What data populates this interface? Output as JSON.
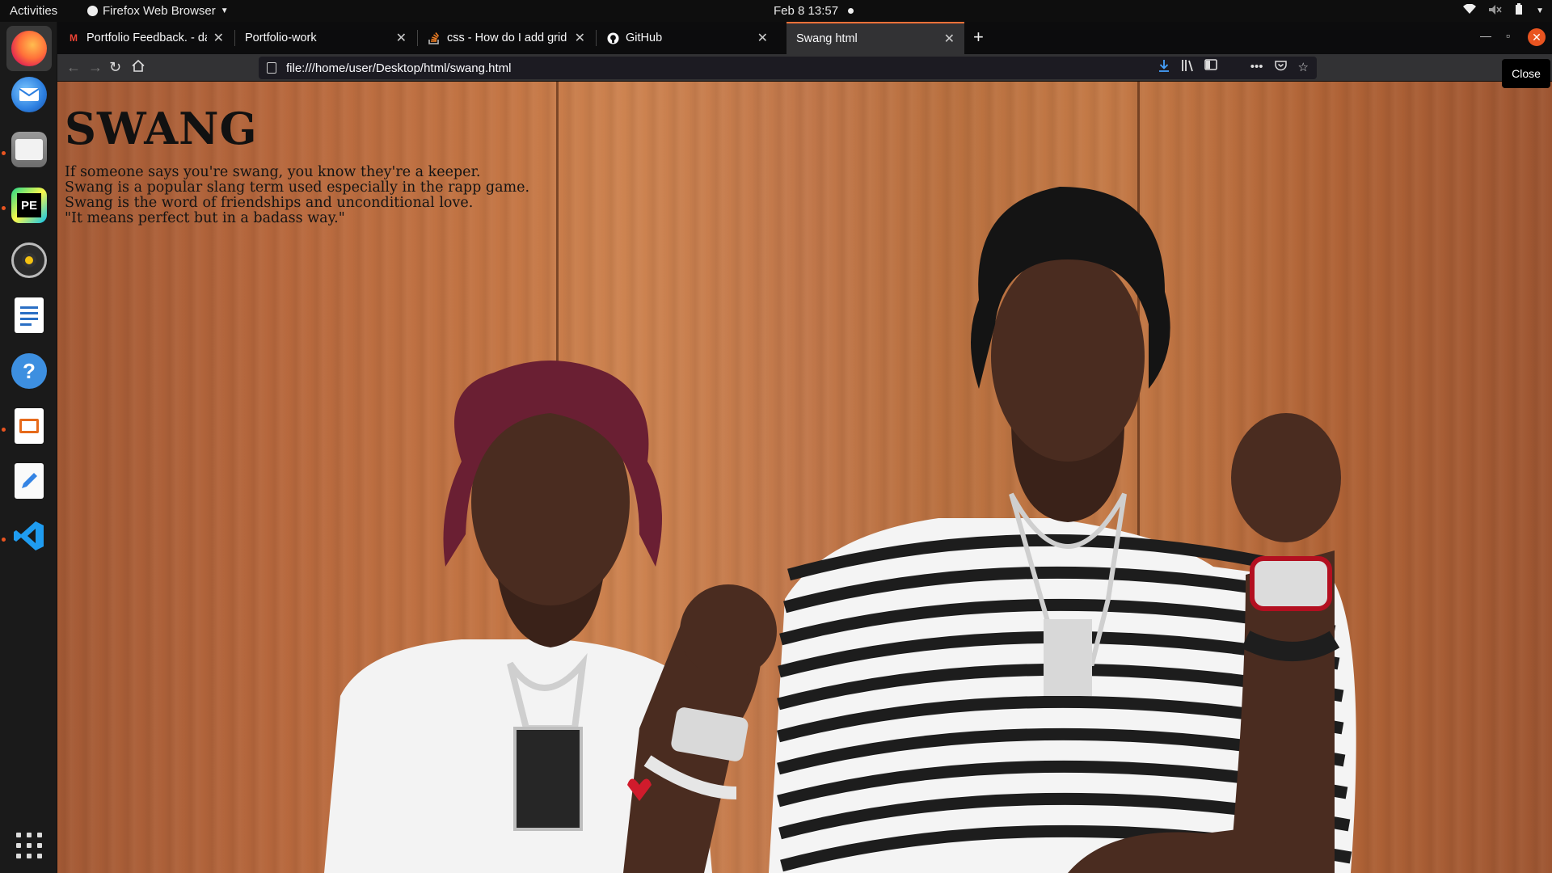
{
  "topbar": {
    "activities": "Activities",
    "app_name": "Firefox Web Browser",
    "clock": "Feb 8  13:57"
  },
  "dock": {
    "items": [
      "firefox-icon",
      "thunderbird-icon",
      "files-icon",
      "pycharm-icon",
      "rhythmbox-icon",
      "writer-icon",
      "help-icon",
      "impress-icon",
      "text-editor-icon",
      "vscode-icon"
    ],
    "pycharm_label": "PE"
  },
  "browser": {
    "tabs": [
      {
        "label": "Portfolio Feedback. - dal",
        "icon": "gmail-icon"
      },
      {
        "label": "Portfolio-work",
        "icon": ""
      },
      {
        "label": "css - How do I add grid in",
        "icon": "stackoverflow-icon"
      },
      {
        "label": "GitHub",
        "icon": "github-icon"
      },
      {
        "label": "Swang html",
        "icon": ""
      }
    ],
    "url": "file:///home/user/Desktop/html/swang.html",
    "tooltip": "Close"
  },
  "page": {
    "title": "SWANG",
    "lines": [
      "If someone says you're swang, you know they're a keeper.",
      "Swang is a popular slang term used especially in the rapp game.",
      "Swang is the word of friendships and unconditional love.",
      "\"It means perfect but in a badass way.\""
    ]
  },
  "colors": {
    "accent": "#e95420",
    "tab_highlight": "#ff7139",
    "wood": "#c47645"
  }
}
